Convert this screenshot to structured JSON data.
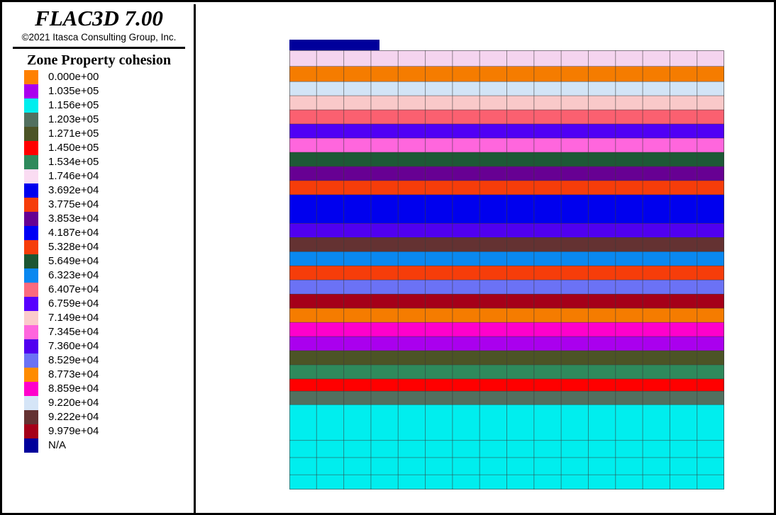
{
  "window": {
    "title": "FLAC3D 7.00",
    "copyright": "©2021 Itasca Consulting Group, Inc."
  },
  "legend": {
    "heading": "Zone Property cohesion",
    "entries": [
      {
        "label": "0.000e+00",
        "color": "#ff8000"
      },
      {
        "label": "1.035e+05",
        "color": "#aa00ee"
      },
      {
        "label": "1.156e+05",
        "color": "#00eeee"
      },
      {
        "label": "1.203e+05",
        "color": "#52705f"
      },
      {
        "label": "1.271e+05",
        "color": "#4c5426"
      },
      {
        "label": "1.450e+05",
        "color": "#ff0000"
      },
      {
        "label": "1.534e+05",
        "color": "#2e8a5c"
      },
      {
        "label": "1.746e+04",
        "color": "#fadcf2"
      },
      {
        "label": "3.692e+04",
        "color": "#0000ee"
      },
      {
        "label": "3.775e+04",
        "color": "#f63d0a"
      },
      {
        "label": "3.853e+04",
        "color": "#670093"
      },
      {
        "label": "4.187e+04",
        "color": "#0000f5"
      },
      {
        "label": "5.328e+04",
        "color": "#f63d0a"
      },
      {
        "label": "5.649e+04",
        "color": "#1b5632"
      },
      {
        "label": "6.323e+04",
        "color": "#0a88f0"
      },
      {
        "label": "6.407e+04",
        "color": "#fb6a7e"
      },
      {
        "label": "6.759e+04",
        "color": "#5700ff"
      },
      {
        "label": "7.149e+04",
        "color": "#fbcbcb"
      },
      {
        "label": "7.345e+04",
        "color": "#ff66dd"
      },
      {
        "label": "7.360e+04",
        "color": "#5000f0"
      },
      {
        "label": "8.529e+04",
        "color": "#6b72f5"
      },
      {
        "label": "8.773e+04",
        "color": "#ff8c00"
      },
      {
        "label": "8.859e+04",
        "color": "#ff00cc"
      },
      {
        "label": "9.220e+04",
        "color": "#d5e5f7"
      },
      {
        "label": "9.222e+04",
        "color": "#643232"
      },
      {
        "label": "9.979e+04",
        "color": "#a50019"
      },
      {
        "label": "N/A",
        "color": "#00009b"
      }
    ]
  },
  "chart_data": {
    "type": "heatmap",
    "title": "Zone Property cohesion",
    "xlabel": "",
    "ylabel": "",
    "grid": true,
    "legend_position": "left-panel",
    "na_bar": {
      "label": "N/A",
      "color": "#00009b",
      "x_fraction": [
        0.0,
        0.207
      ],
      "height_fraction": 0.029
    },
    "columns": 16,
    "bands": [
      {
        "value": "1.746e+04",
        "color": "#f5d4ef",
        "thickness": 26
      },
      {
        "value": "8.773e+04",
        "color": "#f57c00",
        "thickness": 25
      },
      {
        "value": "9.220e+04",
        "color": "#d2e4f6",
        "thickness": 23
      },
      {
        "value": "7.149e+04",
        "color": "#f9c9c9",
        "thickness": 23
      },
      {
        "value": "6.407e+04",
        "color": "#fb6070",
        "thickness": 23
      },
      {
        "value": "6.759e+04",
        "color": "#5000f5",
        "thickness": 23
      },
      {
        "value": "7.345e+04",
        "color": "#ff66dd",
        "thickness": 23
      },
      {
        "value": "5.649e+04",
        "color": "#1e5936",
        "thickness": 23
      },
      {
        "value": "3.853e+04",
        "color": "#670093",
        "thickness": 23
      },
      {
        "value": "5.328e+04",
        "color": "#f63d0a",
        "thickness": 23
      },
      {
        "value": "3.692e+04",
        "color": "#0000ee",
        "thickness": 47
      },
      {
        "value": "7.360e+04",
        "color": "#5000f0",
        "thickness": 23
      },
      {
        "value": "9.222e+04",
        "color": "#643232",
        "thickness": 23
      },
      {
        "value": "6.323e+04",
        "color": "#0a88f0",
        "thickness": 23
      },
      {
        "value": "3.775e+04",
        "color": "#f63d0a",
        "thickness": 23
      },
      {
        "value": "8.529e+04",
        "color": "#6b72f5",
        "thickness": 23
      },
      {
        "value": "9.979e+04",
        "color": "#a50019",
        "thickness": 23
      },
      {
        "value": "8.773e+04",
        "color": "#f57c00",
        "thickness": 23
      },
      {
        "value": "8.859e+04",
        "color": "#ff00cc",
        "thickness": 23
      },
      {
        "value": "1.035e+05",
        "color": "#aa00ee",
        "thickness": 23
      },
      {
        "value": "1.271e+05",
        "color": "#4c5426",
        "thickness": 23
      },
      {
        "value": "1.534e+05",
        "color": "#2e8a5c",
        "thickness": 23
      },
      {
        "value": "1.450e+05",
        "color": "#ff0000",
        "thickness": 20
      },
      {
        "value": "1.203e+05",
        "color": "#52705f",
        "thickness": 22
      },
      {
        "value": "1.156e+05",
        "color": "#00eeee",
        "thickness": 138
      }
    ],
    "horizontal_grid_rows_in_bottom_band": [
      58,
      28,
      28,
      28,
      28
    ]
  }
}
